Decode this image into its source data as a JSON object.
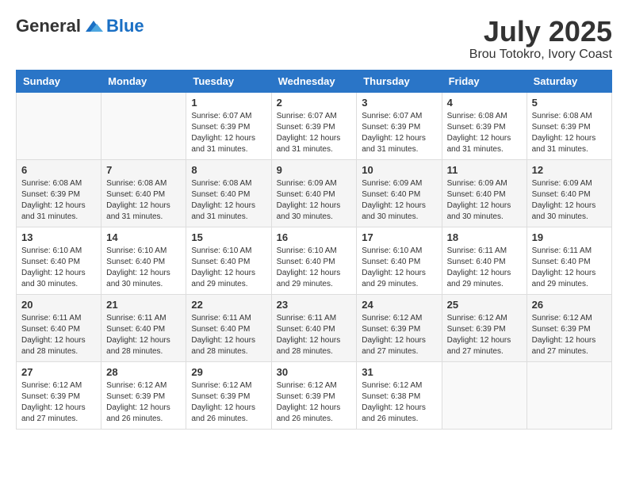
{
  "logo": {
    "general": "General",
    "blue": "Blue"
  },
  "title": "July 2025",
  "location": "Brou Totokro, Ivory Coast",
  "weekdays": [
    "Sunday",
    "Monday",
    "Tuesday",
    "Wednesday",
    "Thursday",
    "Friday",
    "Saturday"
  ],
  "weeks": [
    [
      {
        "day": "",
        "info": ""
      },
      {
        "day": "",
        "info": ""
      },
      {
        "day": "1",
        "info": "Sunrise: 6:07 AM\nSunset: 6:39 PM\nDaylight: 12 hours and 31 minutes."
      },
      {
        "day": "2",
        "info": "Sunrise: 6:07 AM\nSunset: 6:39 PM\nDaylight: 12 hours and 31 minutes."
      },
      {
        "day": "3",
        "info": "Sunrise: 6:07 AM\nSunset: 6:39 PM\nDaylight: 12 hours and 31 minutes."
      },
      {
        "day": "4",
        "info": "Sunrise: 6:08 AM\nSunset: 6:39 PM\nDaylight: 12 hours and 31 minutes."
      },
      {
        "day": "5",
        "info": "Sunrise: 6:08 AM\nSunset: 6:39 PM\nDaylight: 12 hours and 31 minutes."
      }
    ],
    [
      {
        "day": "6",
        "info": "Sunrise: 6:08 AM\nSunset: 6:39 PM\nDaylight: 12 hours and 31 minutes."
      },
      {
        "day": "7",
        "info": "Sunrise: 6:08 AM\nSunset: 6:40 PM\nDaylight: 12 hours and 31 minutes."
      },
      {
        "day": "8",
        "info": "Sunrise: 6:08 AM\nSunset: 6:40 PM\nDaylight: 12 hours and 31 minutes."
      },
      {
        "day": "9",
        "info": "Sunrise: 6:09 AM\nSunset: 6:40 PM\nDaylight: 12 hours and 30 minutes."
      },
      {
        "day": "10",
        "info": "Sunrise: 6:09 AM\nSunset: 6:40 PM\nDaylight: 12 hours and 30 minutes."
      },
      {
        "day": "11",
        "info": "Sunrise: 6:09 AM\nSunset: 6:40 PM\nDaylight: 12 hours and 30 minutes."
      },
      {
        "day": "12",
        "info": "Sunrise: 6:09 AM\nSunset: 6:40 PM\nDaylight: 12 hours and 30 minutes."
      }
    ],
    [
      {
        "day": "13",
        "info": "Sunrise: 6:10 AM\nSunset: 6:40 PM\nDaylight: 12 hours and 30 minutes."
      },
      {
        "day": "14",
        "info": "Sunrise: 6:10 AM\nSunset: 6:40 PM\nDaylight: 12 hours and 30 minutes."
      },
      {
        "day": "15",
        "info": "Sunrise: 6:10 AM\nSunset: 6:40 PM\nDaylight: 12 hours and 29 minutes."
      },
      {
        "day": "16",
        "info": "Sunrise: 6:10 AM\nSunset: 6:40 PM\nDaylight: 12 hours and 29 minutes."
      },
      {
        "day": "17",
        "info": "Sunrise: 6:10 AM\nSunset: 6:40 PM\nDaylight: 12 hours and 29 minutes."
      },
      {
        "day": "18",
        "info": "Sunrise: 6:11 AM\nSunset: 6:40 PM\nDaylight: 12 hours and 29 minutes."
      },
      {
        "day": "19",
        "info": "Sunrise: 6:11 AM\nSunset: 6:40 PM\nDaylight: 12 hours and 29 minutes."
      }
    ],
    [
      {
        "day": "20",
        "info": "Sunrise: 6:11 AM\nSunset: 6:40 PM\nDaylight: 12 hours and 28 minutes."
      },
      {
        "day": "21",
        "info": "Sunrise: 6:11 AM\nSunset: 6:40 PM\nDaylight: 12 hours and 28 minutes."
      },
      {
        "day": "22",
        "info": "Sunrise: 6:11 AM\nSunset: 6:40 PM\nDaylight: 12 hours and 28 minutes."
      },
      {
        "day": "23",
        "info": "Sunrise: 6:11 AM\nSunset: 6:40 PM\nDaylight: 12 hours and 28 minutes."
      },
      {
        "day": "24",
        "info": "Sunrise: 6:12 AM\nSunset: 6:39 PM\nDaylight: 12 hours and 27 minutes."
      },
      {
        "day": "25",
        "info": "Sunrise: 6:12 AM\nSunset: 6:39 PM\nDaylight: 12 hours and 27 minutes."
      },
      {
        "day": "26",
        "info": "Sunrise: 6:12 AM\nSunset: 6:39 PM\nDaylight: 12 hours and 27 minutes."
      }
    ],
    [
      {
        "day": "27",
        "info": "Sunrise: 6:12 AM\nSunset: 6:39 PM\nDaylight: 12 hours and 27 minutes."
      },
      {
        "day": "28",
        "info": "Sunrise: 6:12 AM\nSunset: 6:39 PM\nDaylight: 12 hours and 26 minutes."
      },
      {
        "day": "29",
        "info": "Sunrise: 6:12 AM\nSunset: 6:39 PM\nDaylight: 12 hours and 26 minutes."
      },
      {
        "day": "30",
        "info": "Sunrise: 6:12 AM\nSunset: 6:39 PM\nDaylight: 12 hours and 26 minutes."
      },
      {
        "day": "31",
        "info": "Sunrise: 6:12 AM\nSunset: 6:38 PM\nDaylight: 12 hours and 26 minutes."
      },
      {
        "day": "",
        "info": ""
      },
      {
        "day": "",
        "info": ""
      }
    ]
  ]
}
